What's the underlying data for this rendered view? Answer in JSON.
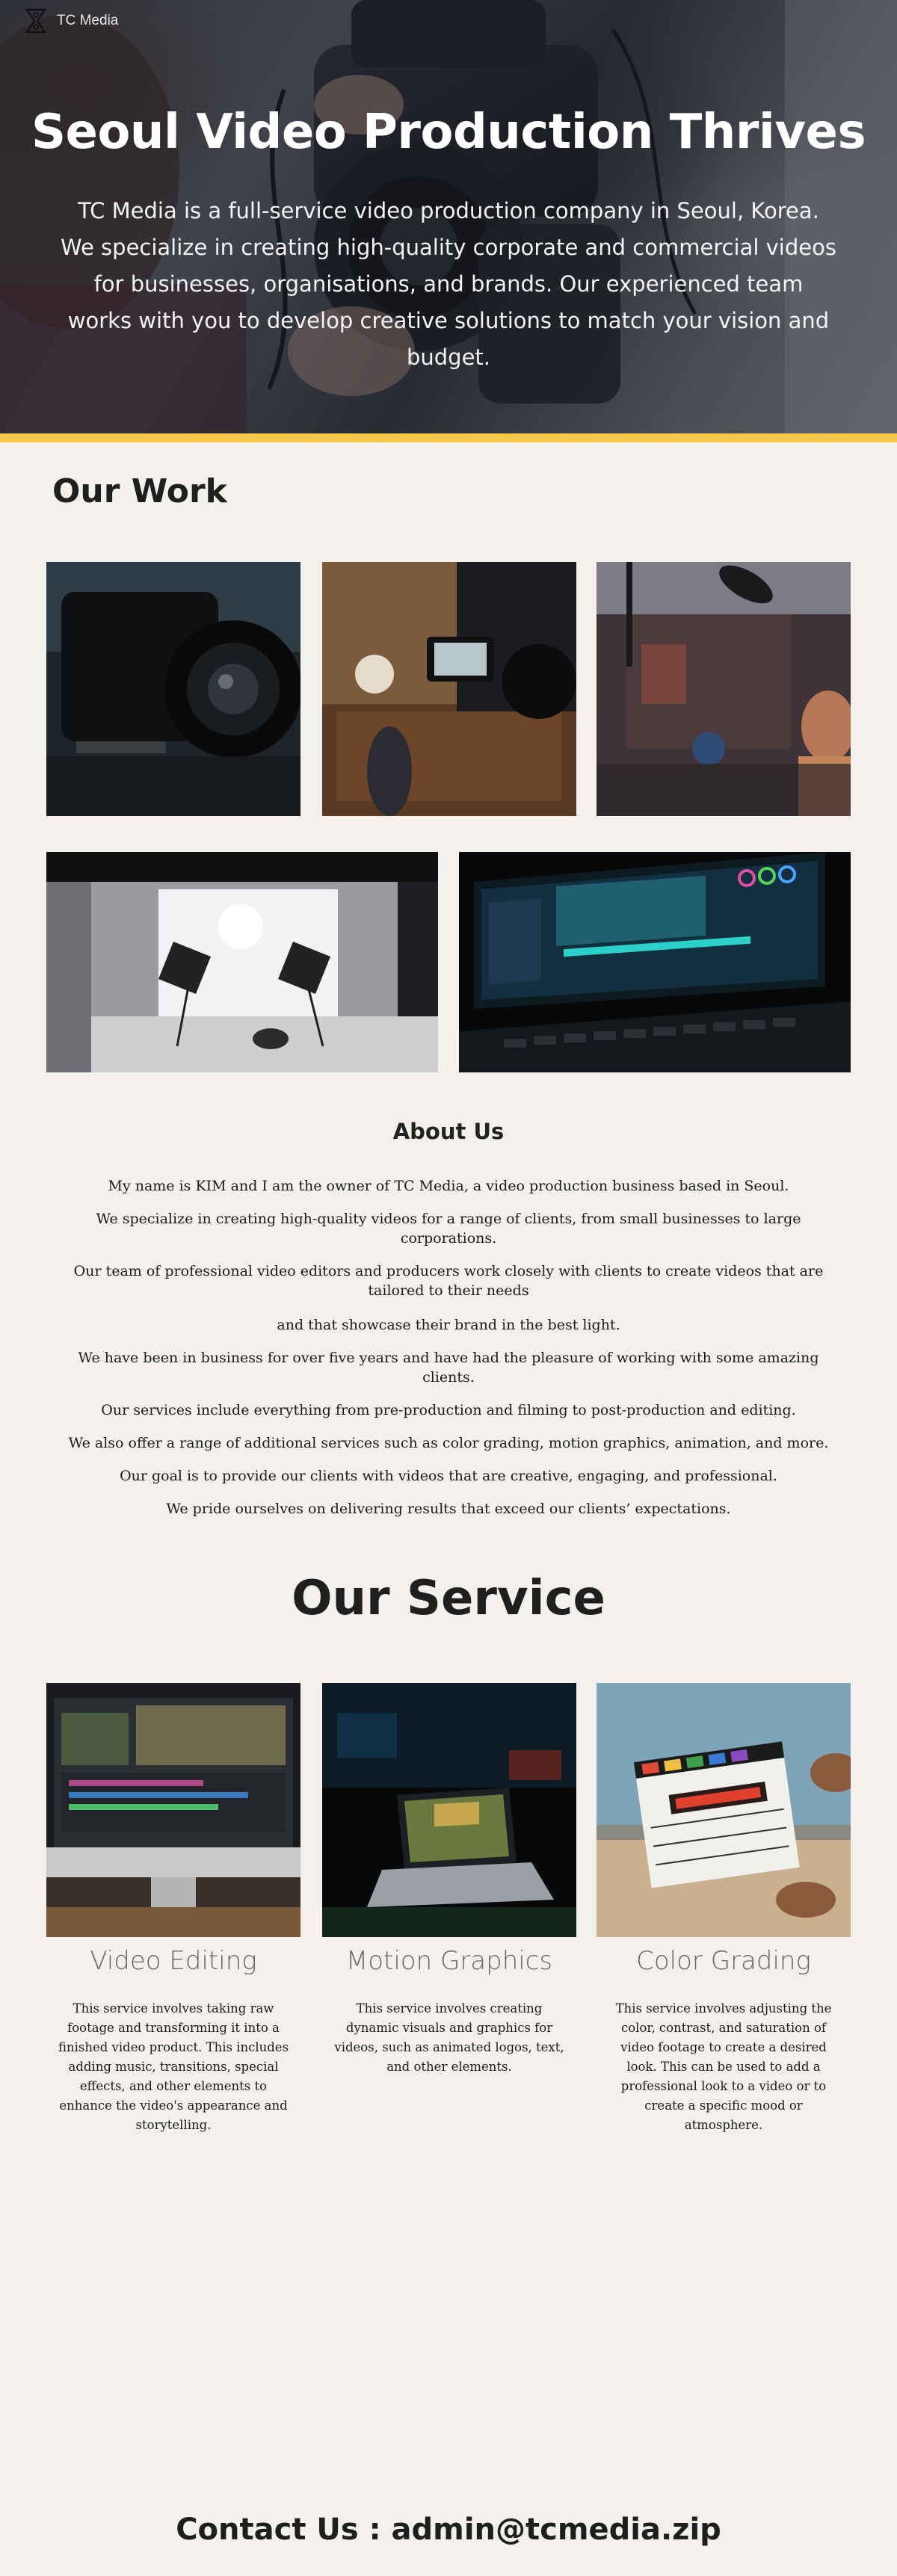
{
  "header": {
    "brand": "TC Media",
    "logo_icon": "film-reel-logo-icon"
  },
  "hero": {
    "title": "Seoul Video Production Thrives",
    "text": "TC Media is a full-service video production company in Seoul, Korea. We specialize in creating high-quality corporate and commercial videos for businesses, organisations, and brands. Our experienced team works with you to develop creative solutions to match your vision and budget.",
    "accent_color": "#f6c94a"
  },
  "work": {
    "title": "Our Work",
    "photos": [
      "cinema-camera-closeup",
      "camera-filming-interview",
      "camera-microphone-subject",
      "photo-studio-lighting",
      "video-editing-monitor"
    ]
  },
  "about": {
    "title": "About Us",
    "lines": [
      "My name is KIM and I am the owner of TC Media, a video production business based in Seoul.",
      "We specialize in creating high-quality videos for a range of clients, from small businesses to large corporations.",
      "Our team of professional video editors and producers work closely with clients to create videos that are tailored to their needs",
      "and that showcase their brand in the best light.",
      "We have been in business for over five years and have had the pleasure of working with some amazing clients.",
      "Our services include everything from pre-production and filming to post-production and editing.",
      "We also offer a range of additional services such as color grading, motion graphics, animation, and more.",
      "Our goal is to provide our clients with videos that are creative, engaging, and professional.",
      "We pride ourselves on delivering results that exceed our clients’ expectations."
    ]
  },
  "service": {
    "title": "Our Service",
    "items": [
      {
        "name": "Video Editing",
        "description": "This service involves taking raw footage and transforming it into a finished video product. This includes adding music, transitions, special effects, and other elements to enhance the video's appearance and storytelling."
      },
      {
        "name": "Motion Graphics",
        "description": "This service involves creating dynamic visuals and graphics for videos, such as animated logos, text, and other elements."
      },
      {
        "name": "Color Grading",
        "description": "This service involves adjusting the color, contrast, and saturation of video footage to create a desired look. This can be used to add a professional look to a video or to create a specific mood or atmosphere."
      }
    ]
  },
  "contact": {
    "text": "Contact Us : admin@tcmedia.zip"
  }
}
